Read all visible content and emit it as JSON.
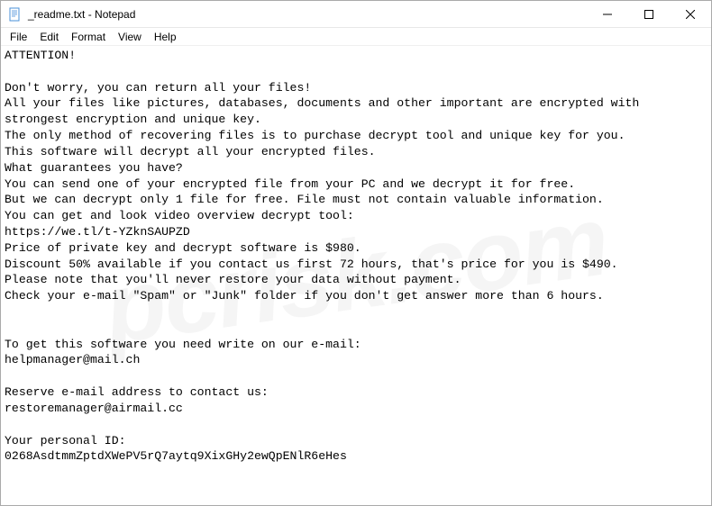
{
  "titlebar": {
    "filename": "_readme.txt - Notepad"
  },
  "menubar": {
    "items": [
      "File",
      "Edit",
      "Format",
      "View",
      "Help"
    ]
  },
  "document": {
    "lines": [
      "ATTENTION!",
      "",
      "Don't worry, you can return all your files!",
      "All your files like pictures, databases, documents and other important are encrypted with strongest encryption and unique key.",
      "The only method of recovering files is to purchase decrypt tool and unique key for you.",
      "This software will decrypt all your encrypted files.",
      "What guarantees you have?",
      "You can send one of your encrypted file from your PC and we decrypt it for free.",
      "But we can decrypt only 1 file for free. File must not contain valuable information.",
      "You can get and look video overview decrypt tool:",
      "https://we.tl/t-YZknSAUPZD",
      "Price of private key and decrypt software is $980.",
      "Discount 50% available if you contact us first 72 hours, that's price for you is $490.",
      "Please note that you'll never restore your data without payment.",
      "Check your e-mail \"Spam\" or \"Junk\" folder if you don't get answer more than 6 hours.",
      "",
      "",
      "To get this software you need write on our e-mail:",
      "helpmanager@mail.ch",
      "",
      "Reserve e-mail address to contact us:",
      "restoremanager@airmail.cc",
      "",
      "Your personal ID:",
      "0268AsdtmmZptdXWePV5rQ7aytq9XixGHy2ewQpENlR6eHes"
    ]
  },
  "watermark": "pcrisk.com"
}
